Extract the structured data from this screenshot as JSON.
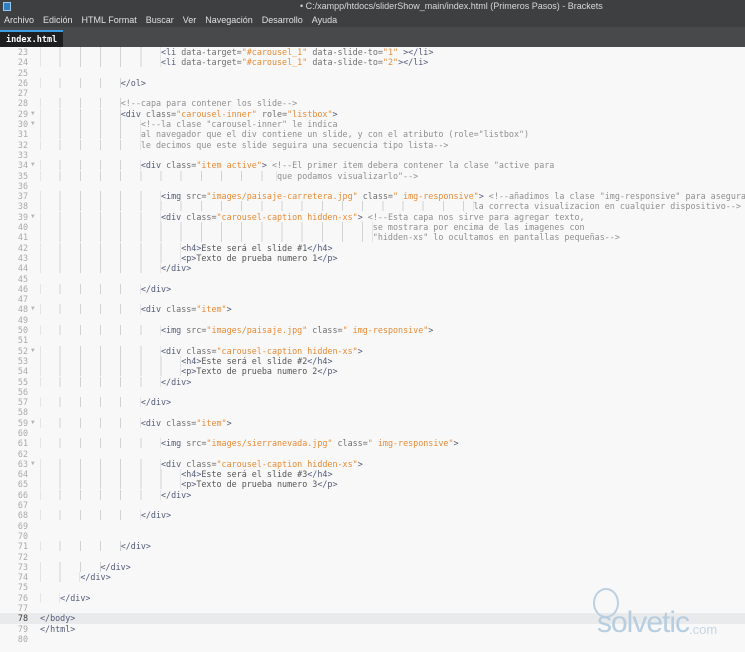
{
  "window": {
    "title": "• C:/xampp/htdocs/sliderShow_main/index.html (Primeros Pasos) - Brackets"
  },
  "menu": [
    "Archivo",
    "Edición",
    "HTML Format",
    "Buscar",
    "Ver",
    "Navegación",
    "Desarrollo",
    "Ayuda"
  ],
  "tab": {
    "label": "index.html"
  },
  "watermark": {
    "text": "solvetic",
    "suffix": ".com"
  },
  "editor": {
    "active_line": 78,
    "lines": [
      {
        "n": 23,
        "t": "                        <li data-target=\"#carousel_1\" data-slide-to=\"1\" ></li>"
      },
      {
        "n": 24,
        "t": "                        <li data-target=\"#carousel_1\" data-slide-to=\"2\"></li>"
      },
      {
        "n": 25,
        "t": ""
      },
      {
        "n": 26,
        "t": "                </ol>"
      },
      {
        "n": 27,
        "t": ""
      },
      {
        "n": 28,
        "t": "                <!--capa para contener los slide-->"
      },
      {
        "n": 29,
        "t": "                <div class=\"carousel-inner\" role=\"listbox\">",
        "f": true
      },
      {
        "n": 30,
        "t": "                    <!--la clase \"carousel-inner\" le indica",
        "f": true
      },
      {
        "n": 31,
        "t": "                    al navegador que el div contiene un slide, y con el atributo (role=\"listbox\")",
        "c": true
      },
      {
        "n": 32,
        "t": "                    le decimos que este slide seguira una secuencia tipo lista-->",
        "c": true
      },
      {
        "n": 33,
        "t": ""
      },
      {
        "n": 34,
        "t": "                    <div class=\"item active\"> <!--El primer item debera contener la clase \"active para",
        "f": true
      },
      {
        "n": 35,
        "t": "                                               que podamos visualizarlo\"-->",
        "c": true
      },
      {
        "n": 36,
        "t": ""
      },
      {
        "n": 37,
        "t": "                        <img src=\"images/paisaje-carretera.jpg\" class=\" img-responsive\"> <!--añadimos la clase \"img-responsive\" para asegurar"
      },
      {
        "n": 38,
        "t": "                                                                                      la correcta visualizacion en cualquier dispositivo-->",
        "c": true
      },
      {
        "n": 39,
        "t": "                        <div class=\"carousel-caption hidden-xs\"> <!--Esta capa nos sirve para agregar texto,",
        "f": true
      },
      {
        "n": 40,
        "t": "                                                                  se mostrara por encima de las imagenes con",
        "c": true
      },
      {
        "n": 41,
        "t": "                                                                  \"hidden-xs\" lo ocultamos en pantallas pequeñas-->",
        "c": true
      },
      {
        "n": 42,
        "t": "                            <h4>Este será el slide #1</h4>"
      },
      {
        "n": 43,
        "t": "                            <p>Texto de prueba numero 1</p>"
      },
      {
        "n": 44,
        "t": "                        </div>"
      },
      {
        "n": 45,
        "t": ""
      },
      {
        "n": 46,
        "t": "                    </div>"
      },
      {
        "n": 47,
        "t": ""
      },
      {
        "n": 48,
        "t": "                    <div class=\"item\">",
        "f": true
      },
      {
        "n": 49,
        "t": ""
      },
      {
        "n": 50,
        "t": "                        <img src=\"images/paisaje.jpg\" class=\" img-responsive\">"
      },
      {
        "n": 51,
        "t": ""
      },
      {
        "n": 52,
        "t": "                        <div class=\"carousel-caption hidden-xs\">",
        "f": true
      },
      {
        "n": 53,
        "t": "                            <h4>Este será el slide #2</h4>"
      },
      {
        "n": 54,
        "t": "                            <p>Texto de prueba numero 2</p>"
      },
      {
        "n": 55,
        "t": "                        </div>"
      },
      {
        "n": 56,
        "t": ""
      },
      {
        "n": 57,
        "t": "                    </div>"
      },
      {
        "n": 58,
        "t": ""
      },
      {
        "n": 59,
        "t": "                    <div class=\"item\">",
        "f": true
      },
      {
        "n": 60,
        "t": ""
      },
      {
        "n": 61,
        "t": "                        <img src=\"images/sierranevada.jpg\" class=\" img-responsive\">"
      },
      {
        "n": 62,
        "t": ""
      },
      {
        "n": 63,
        "t": "                        <div class=\"carousel-caption hidden-xs\">",
        "f": true
      },
      {
        "n": 64,
        "t": "                            <h4>Este será el slide #3</h4>"
      },
      {
        "n": 65,
        "t": "                            <p>Texto de prueba numero 3</p>"
      },
      {
        "n": 66,
        "t": "                        </div>"
      },
      {
        "n": 67,
        "t": ""
      },
      {
        "n": 68,
        "t": "                    </div>"
      },
      {
        "n": 69,
        "t": ""
      },
      {
        "n": 70,
        "t": ""
      },
      {
        "n": 71,
        "t": "                </div>"
      },
      {
        "n": 72,
        "t": ""
      },
      {
        "n": 73,
        "t": "            </div>"
      },
      {
        "n": 74,
        "t": "        </div>"
      },
      {
        "n": 75,
        "t": ""
      },
      {
        "n": 76,
        "t": "    </div>"
      },
      {
        "n": 77,
        "t": ""
      },
      {
        "n": 78,
        "t": "</body>"
      },
      {
        "n": 79,
        "t": "</html>"
      },
      {
        "n": 80,
        "t": ""
      }
    ]
  }
}
